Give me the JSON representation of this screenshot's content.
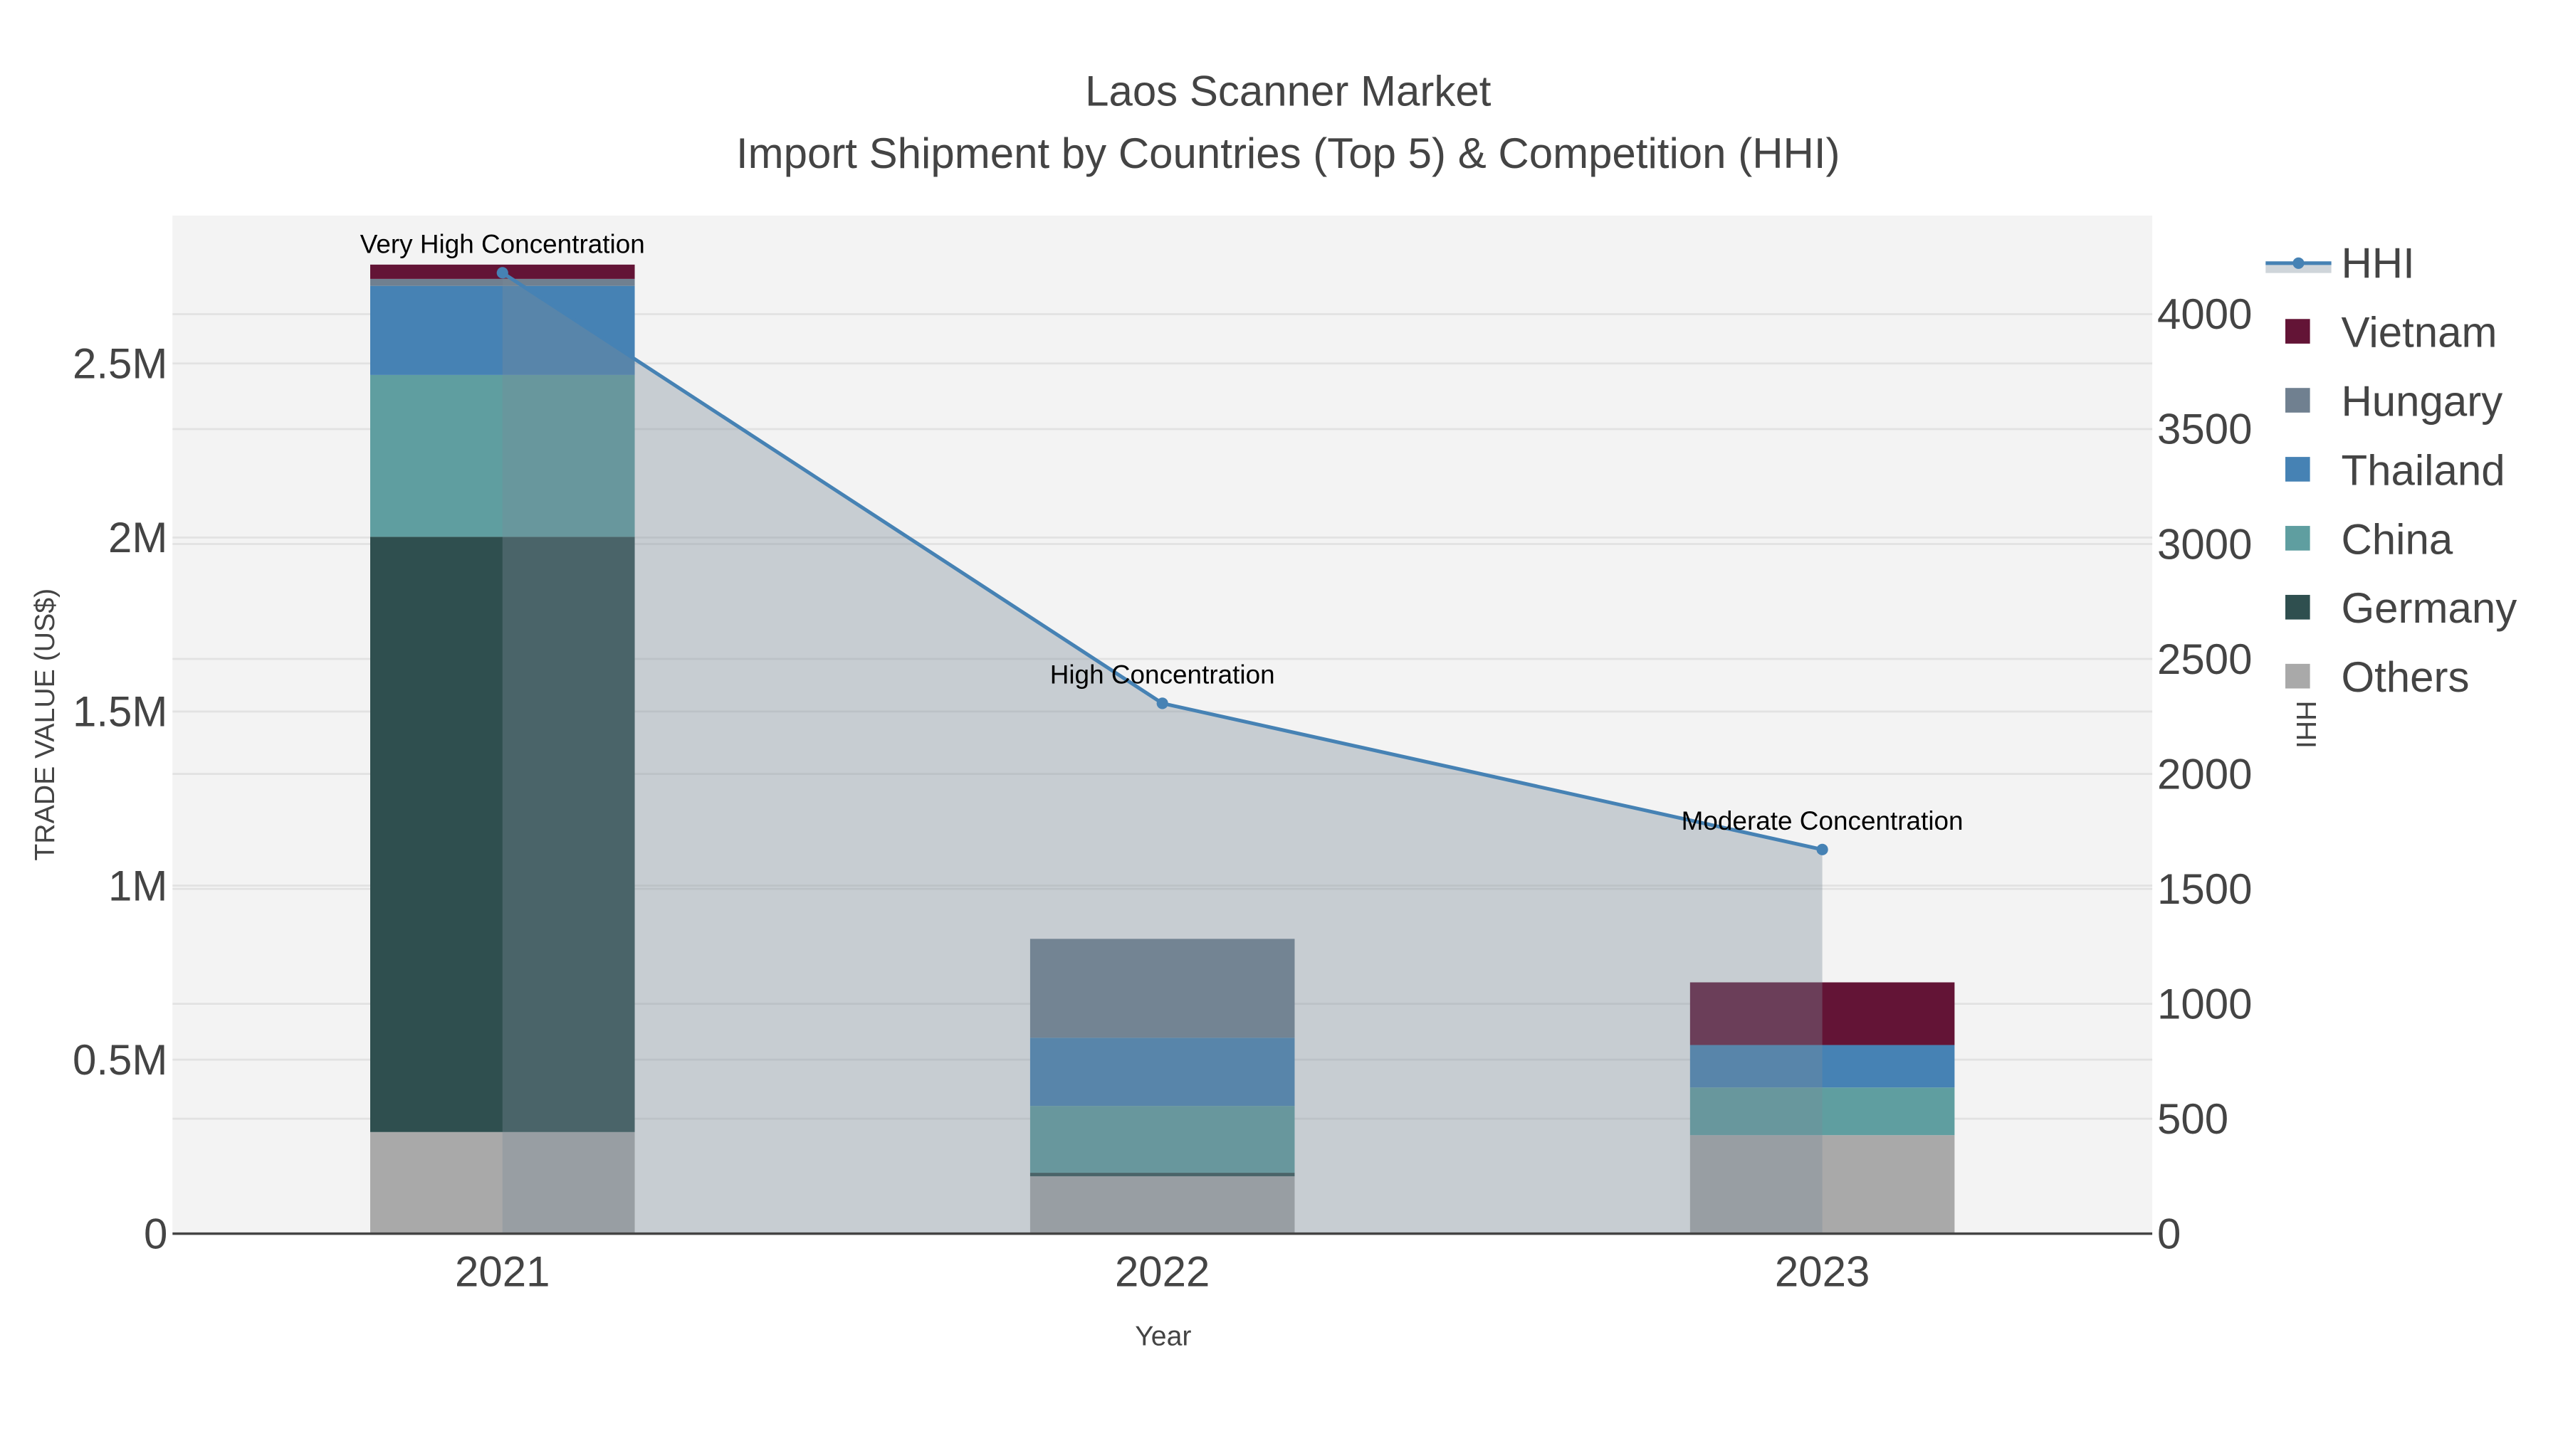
{
  "chart_data": {
    "type": "bar",
    "title": "Laos Scanner Market",
    "subtitle": "Import Shipment by Countries (Top 5) & Competition (HHI)",
    "xlabel": "Year",
    "ylabel": "TRADE VALUE (US$)",
    "y2label": "HHI",
    "categories": [
      "2021",
      "2022",
      "2023"
    ],
    "ylim": [
      0,
      2925000
    ],
    "y2lim": [
      0,
      4429
    ],
    "yticks": [
      0,
      500000,
      1000000,
      1500000,
      2000000,
      2500000
    ],
    "yticklabels": [
      "0",
      "0.5M",
      "1M",
      "1.5M",
      "2M",
      "2.5M"
    ],
    "y2ticks": [
      0,
      500,
      1000,
      1500,
      2000,
      2500,
      3000,
      3500,
      4000
    ],
    "y2ticklabels": [
      "0",
      "500",
      "1000",
      "1500",
      "2000",
      "2500",
      "3000",
      "3500",
      "4000"
    ],
    "grid": true,
    "legend_placement": "right",
    "series": [
      {
        "name": "Others",
        "color": "#a9a9a9",
        "values": [
          292000,
          165000,
          283000
        ]
      },
      {
        "name": "Germany",
        "color": "#2f4f4f",
        "values": [
          1710000,
          10000,
          0
        ]
      },
      {
        "name": "China",
        "color": "#5f9ea0",
        "values": [
          465000,
          192000,
          137000
        ]
      },
      {
        "name": "Thailand",
        "color": "#4682b4",
        "values": [
          256000,
          196000,
          122000
        ]
      },
      {
        "name": "Hungary",
        "color": "#708090",
        "values": [
          20000,
          284000,
          0
        ]
      },
      {
        "name": "Vietnam",
        "color": "#631436",
        "values": [
          41000,
          0,
          180000
        ]
      }
    ],
    "line": {
      "name": "HHI",
      "color": "#4682b4",
      "values": [
        4180,
        2307,
        1671
      ],
      "annotations": [
        "Very High Concentration",
        "High Concentration",
        "Moderate Concentration"
      ]
    },
    "legend_order": [
      "HHI",
      "Vietnam",
      "Hungary",
      "Thailand",
      "China",
      "Germany",
      "Others"
    ]
  }
}
